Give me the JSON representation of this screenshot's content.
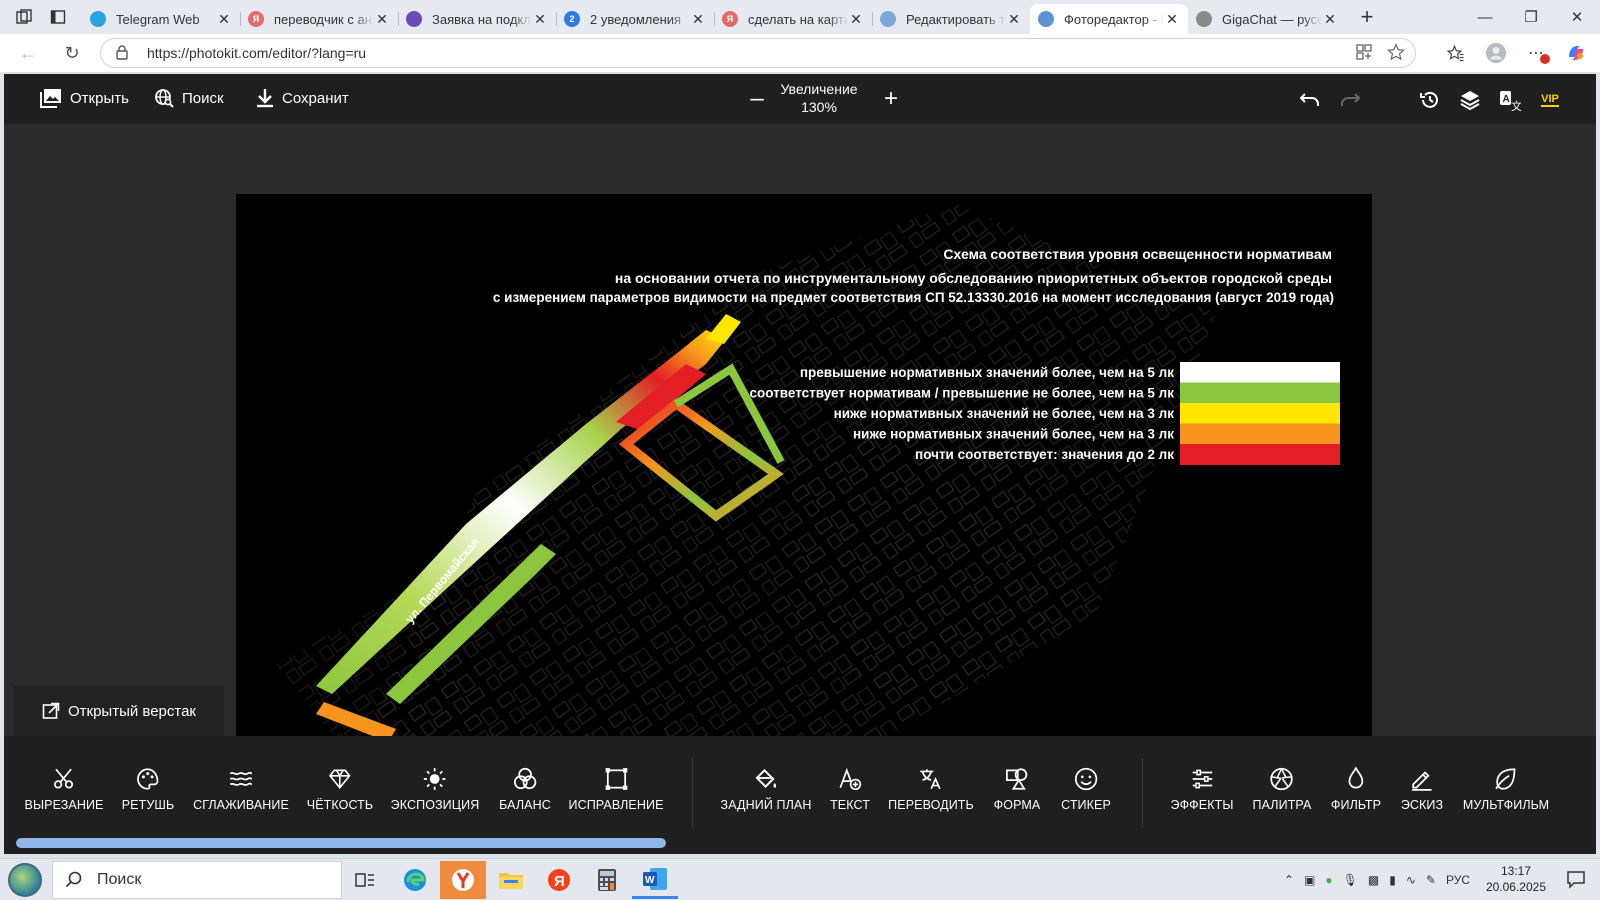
{
  "browser": {
    "tabs": [
      {
        "label": "Telegram Web",
        "color": "#2aa3e0",
        "glyph": ""
      },
      {
        "label": "переводчик с англ",
        "color": "#e06b6b",
        "glyph": "Я"
      },
      {
        "label": "Заявка на подклю",
        "color": "#6b4bb8",
        "glyph": ""
      },
      {
        "label": "2 уведомления",
        "color": "#2a7de0",
        "glyph": "2"
      },
      {
        "label": "сделать на картин",
        "color": "#e06b6b",
        "glyph": "Я"
      },
      {
        "label": "Редактировать тек",
        "color": "#7aa7d9",
        "glyph": ""
      },
      {
        "label": "Фоторедактор - Р",
        "color": "#5a93d6",
        "glyph": ""
      },
      {
        "label": "GigaChat — русск",
        "color": "#8a8a8a",
        "glyph": ""
      }
    ],
    "active_tab": 6,
    "url": "https://photokit.com/editor/?lang=ru"
  },
  "editor": {
    "open_label": "Открыть",
    "search_label": "Поиск",
    "save_label": "Сохранит",
    "zoom_label": "Увеличение",
    "zoom_value": "130%",
    "vip_label": "VIP",
    "layout_label": "Открытый верстак",
    "tools_left": [
      "ВЫРЕЗАНИЕ",
      "РЕТУШЬ",
      "СГЛАЖИВАНИЕ",
      "ЧЁТКОСТЬ",
      "ЭКСПОЗИЦИЯ",
      "БАЛАНС",
      "ИСПРАВЛЕНИЕ"
    ],
    "tools_mid": [
      "ЗАДНИЙ ПЛАН",
      "ТЕКСТ",
      "ПЕРЕВОДИТЬ",
      "ФОРМА",
      "СТИКЕР"
    ],
    "tools_right": [
      "ЭФФЕКТЫ",
      "ПАЛИТРА",
      "ФИЛЬТР",
      "ЭСКИЗ",
      "МУЛЬТФИЛЬМ"
    ]
  },
  "image": {
    "title_lines": [
      "Схема соответствия уровня освещенности нормативам",
      "на основании отчета по инструментальному обследованию приоритетных объектов городской среды",
      "с измерением параметров видимости на предмет соответствия СП 52.13330.2016 на момент исследования (август 2019 года)"
    ],
    "legend": [
      {
        "label": "превышение нормативных значений более, чем на 5 лк",
        "color": "#ffffff"
      },
      {
        "label": "соответствует нормативам / превышение не более, чем на 5 лк",
        "color": "#8cc63f"
      },
      {
        "label": "ниже нормативных значений не более, чем на 3 лк",
        "color": "#ffe600"
      },
      {
        "label": "ниже нормативных значений более, чем на 3 лк",
        "color": "#f7941d"
      },
      {
        "label": "почти соответствует: значения до 2 лк",
        "color": "#e31e24"
      }
    ],
    "street_label": "ул. Первомайская"
  },
  "taskbar": {
    "search_label": "Поиск",
    "lang": "РУС",
    "time": "13:17",
    "date": "20.06.2025"
  }
}
